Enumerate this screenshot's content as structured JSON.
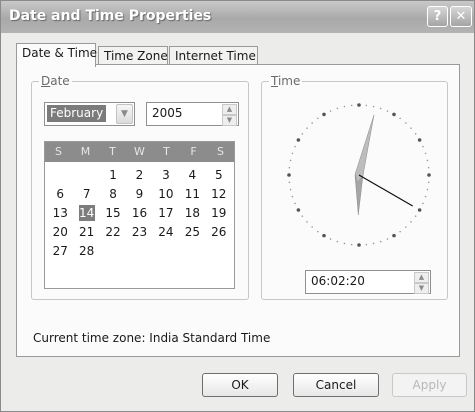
{
  "window": {
    "title": "Date and Time Properties",
    "help_glyph": "?",
    "close_glyph": "✕"
  },
  "tabs": [
    {
      "label": "Date & Time",
      "active": true
    },
    {
      "label": "Time Zone",
      "active": false
    },
    {
      "label": "Internet Time",
      "active": false
    }
  ],
  "date_group": {
    "label_accel": "D",
    "label_rest": "ate",
    "month": "February",
    "year": "2005",
    "weekday_headers": [
      "S",
      "M",
      "T",
      "W",
      "T",
      "F",
      "S"
    ],
    "days": [
      "",
      "",
      "1",
      "2",
      "3",
      "4",
      "5",
      "6",
      "7",
      "8",
      "9",
      "10",
      "11",
      "12",
      "13",
      "14",
      "15",
      "16",
      "17",
      "18",
      "19",
      "20",
      "21",
      "22",
      "23",
      "24",
      "25",
      "26",
      "27",
      "28"
    ],
    "selected_day": "14"
  },
  "time_group": {
    "label_accel": "T",
    "label_rest": "ime",
    "time_value": "06:02:20",
    "clock": {
      "hours": 6,
      "minutes": 2,
      "seconds": 20
    }
  },
  "current_time_zone": "Current time zone:  India Standard Time",
  "buttons": {
    "ok": "OK",
    "cancel": "Cancel",
    "apply": "Apply"
  },
  "colors": {
    "title_bar": "#b0b0b0",
    "selection": "#7d7d7d",
    "calendar_header": "#8c8c8c"
  },
  "icons": {
    "help": "question-icon",
    "close": "close-icon",
    "dropdown": "chevron-down-icon",
    "spin_up": "arrow-up-icon",
    "spin_down": "arrow-down-icon"
  }
}
